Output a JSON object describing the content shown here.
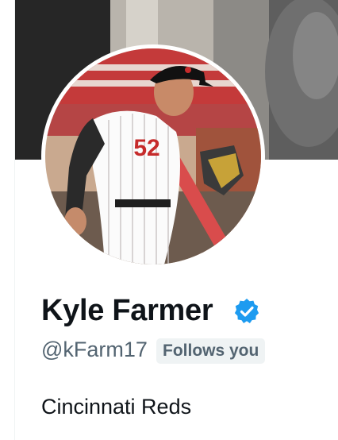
{
  "profile": {
    "display_name": "Kyle Farmer",
    "handle": "@kFarm17",
    "follows_badge": "Follows you",
    "bio": "Cincinnati Reds",
    "verified_icon": "verified-badge-icon",
    "verified_color": "#1d9bf0",
    "jersey_number": "52"
  }
}
